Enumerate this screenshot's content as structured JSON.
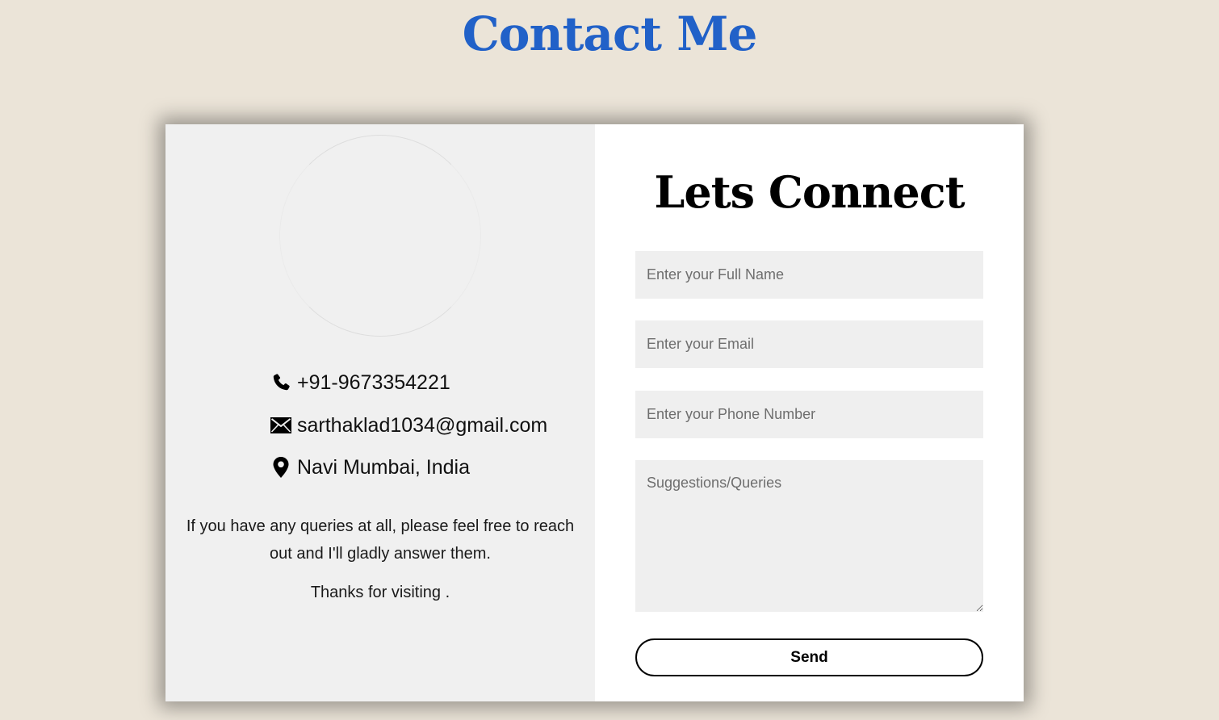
{
  "header": {
    "title": "Contact Me",
    "title_color": "#2161c8"
  },
  "contact": {
    "phone": "+91-9673354221",
    "phone_icon": "phone-icon",
    "email": "sarthaklad1034@gmail.com",
    "email_icon": "envelope-icon",
    "location": "Navi Mumbai, India",
    "location_icon": "map-pin-icon",
    "message": "If you have any queries at all, please feel free to reach out and I'll gladly answer them.",
    "thanks": "Thanks for visiting ."
  },
  "form": {
    "title": "Lets Connect",
    "name_placeholder": "Enter your Full Name",
    "email_placeholder": "Enter your Email",
    "phone_placeholder": "Enter your Phone Number",
    "query_placeholder": "Suggestions/Queries",
    "send_label": "Send"
  },
  "colors": {
    "page_background": "#ebe4d8",
    "info_panel": "#f0f0f0",
    "form_panel": "#ffffff",
    "field_background": "#efefef"
  }
}
